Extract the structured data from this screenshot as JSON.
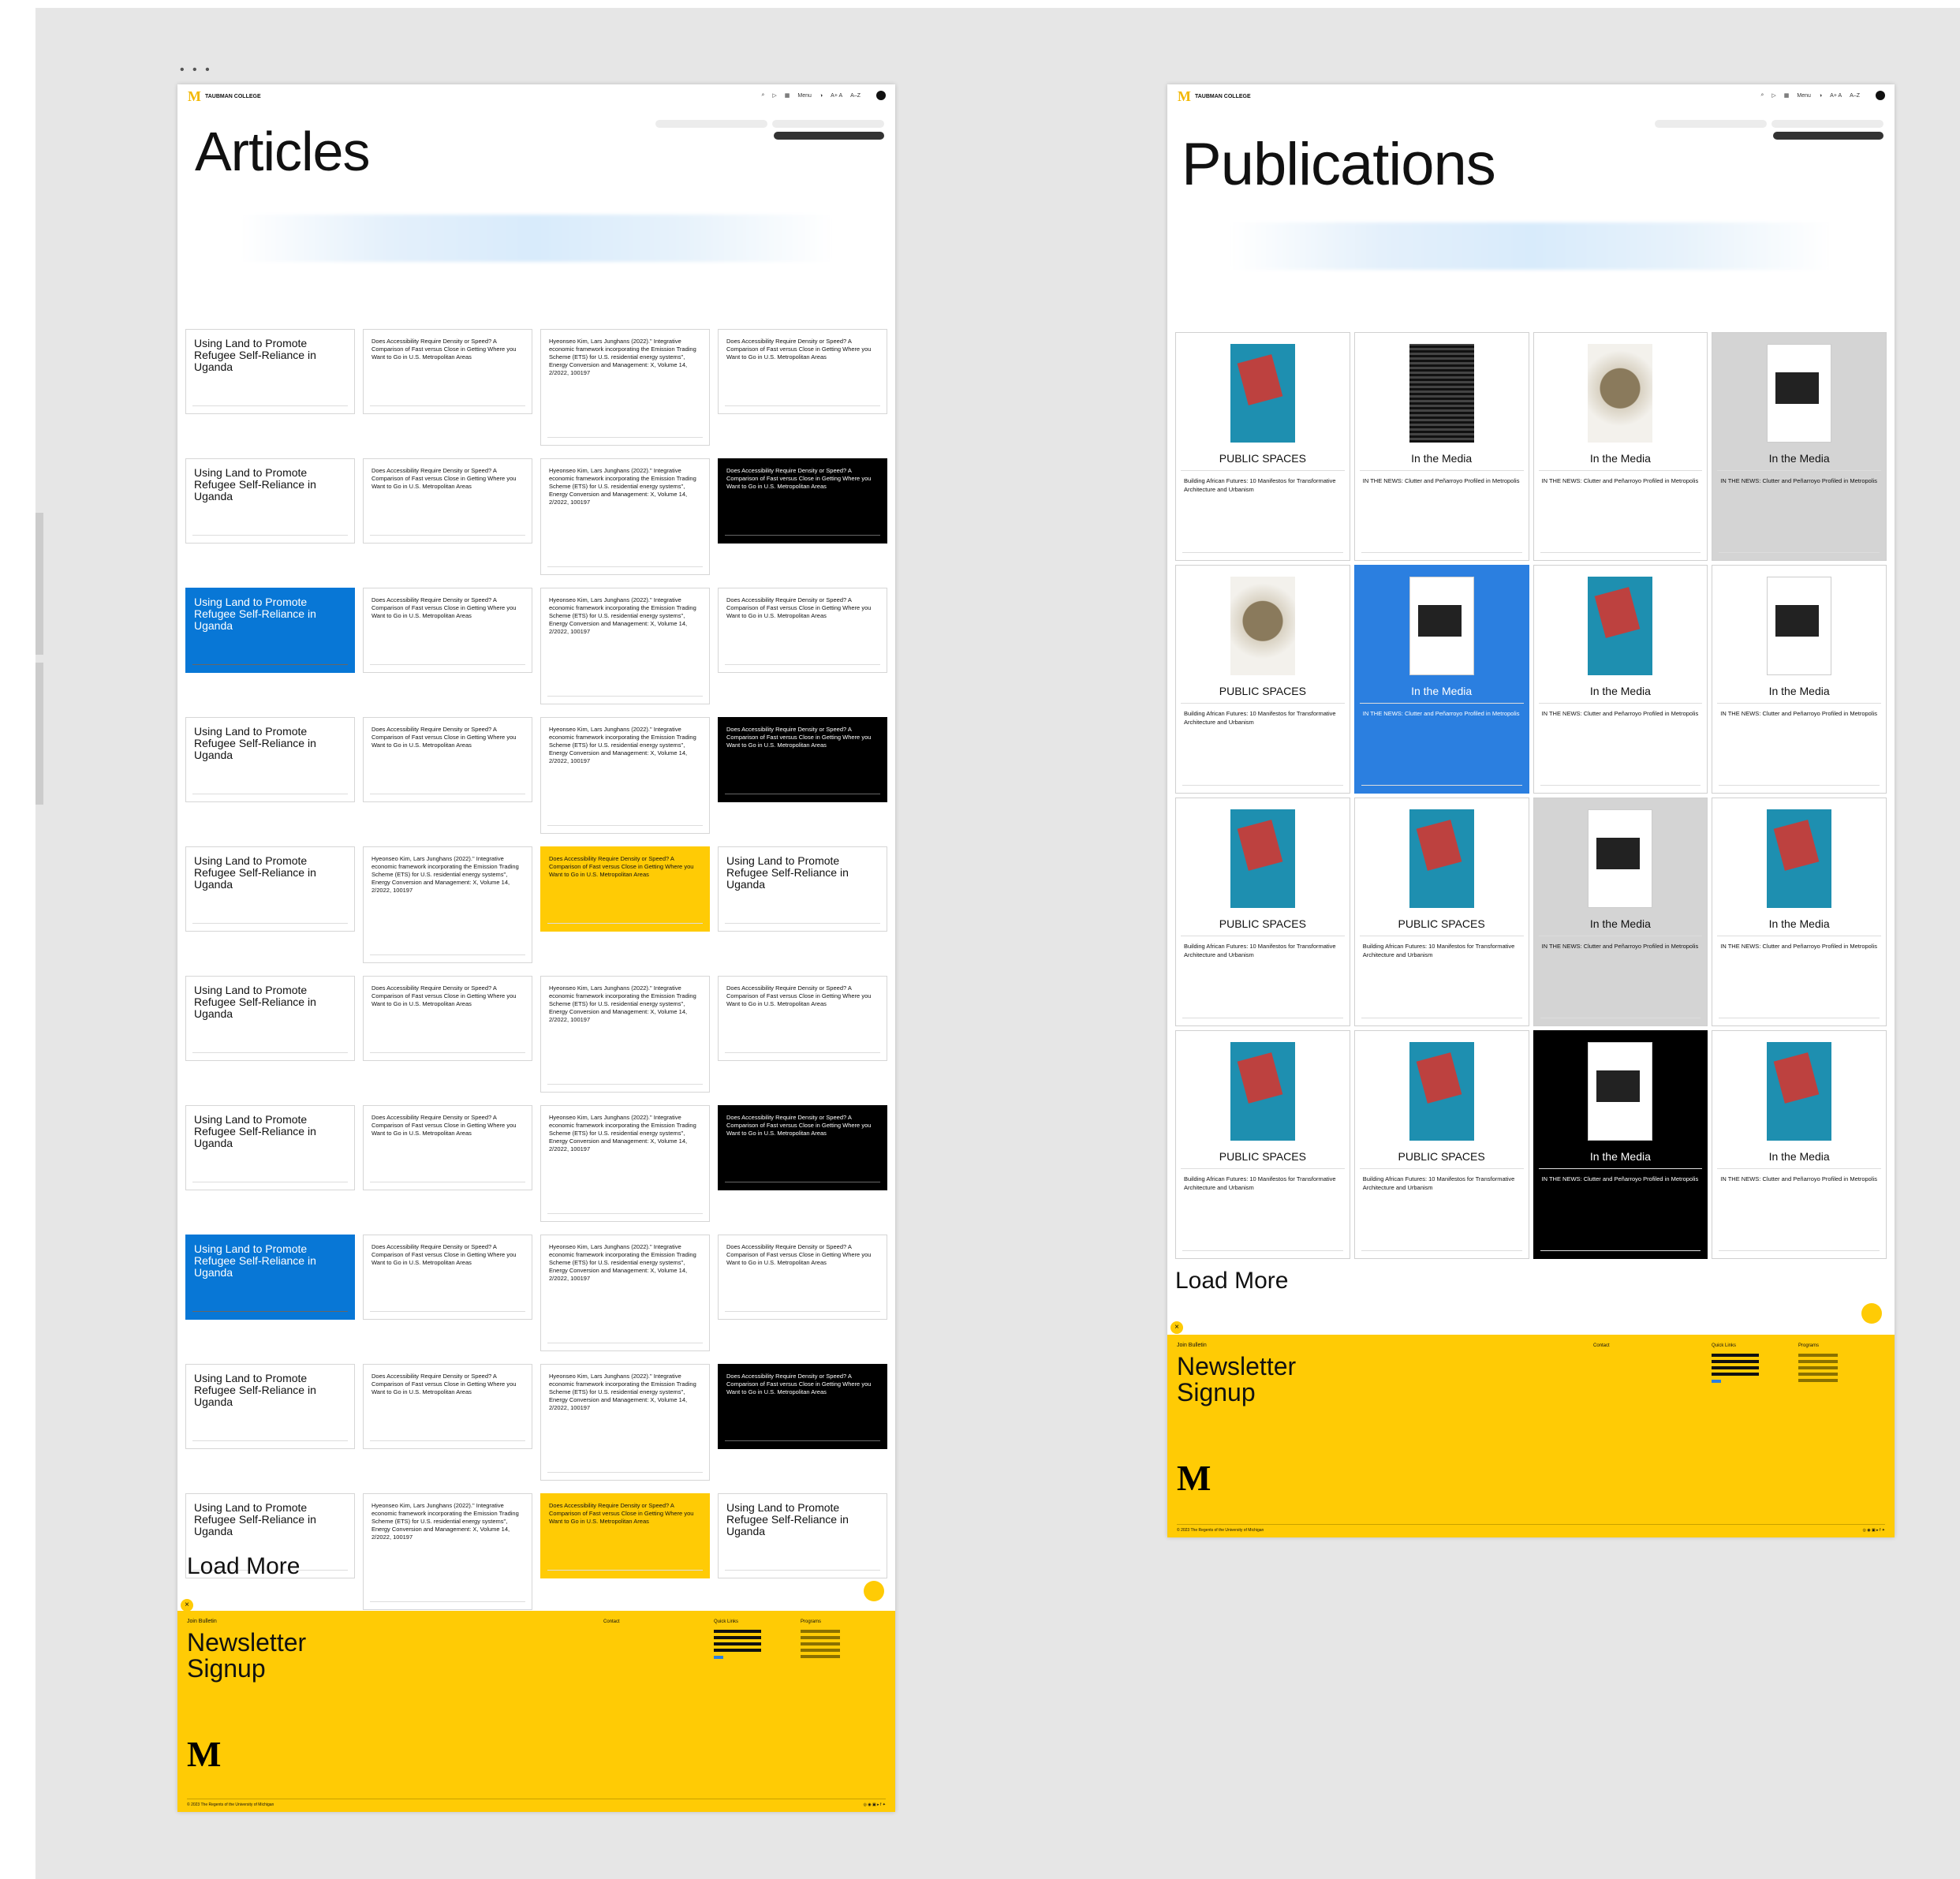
{
  "header": {
    "logo": "TAUBMAN COLLEGE",
    "menu": "Menu",
    "fontsize": "A+ A",
    "az": "A–Z",
    "user": ""
  },
  "articles": {
    "title": "Articles",
    "filter1": "",
    "filter2": "",
    "search": "",
    "loadmore": "Load More",
    "texts": {
      "A": "Using Land to Promote Refugee Self-Reliance in Uganda",
      "B": "Does Accessibility Require Density or Speed? A Comparison of Fast versus Close in Getting Where you Want to Go in U.S. Metropolitan Areas",
      "C": "Hyeonseo Kim, Lars Junghans (2022).\" Integrative economic framework incorporating the Emission Trading Scheme (ETS) for U.S. residential energy systems\", Energy Conversion and Management: X, Volume 14, 2/2022, 100197"
    },
    "rows": [
      [
        [
          "A",
          "w"
        ],
        [
          "B",
          "w"
        ],
        [
          "C",
          "w"
        ],
        [
          "B",
          "w"
        ]
      ],
      [
        [
          "A",
          "w"
        ],
        [
          "B",
          "w"
        ],
        [
          "C",
          "w"
        ],
        [
          "B",
          "k"
        ]
      ],
      [
        [
          "A",
          "b"
        ],
        [
          "B",
          "w"
        ],
        [
          "C",
          "w"
        ],
        [
          "B",
          "w"
        ]
      ],
      [
        [
          "A",
          "w"
        ],
        [
          "B",
          "w"
        ],
        [
          "C",
          "w"
        ],
        [
          "B",
          "k"
        ]
      ],
      [
        [
          "A",
          "w"
        ],
        [
          "C",
          "w"
        ],
        [
          "B",
          "y"
        ],
        [
          "A",
          "w"
        ]
      ],
      [
        [
          "A",
          "w"
        ],
        [
          "B",
          "w"
        ],
        [
          "C",
          "w"
        ],
        [
          "B",
          "w"
        ]
      ],
      [
        [
          "A",
          "w"
        ],
        [
          "B",
          "w"
        ],
        [
          "C",
          "w"
        ],
        [
          "B",
          "k"
        ]
      ],
      [
        [
          "A",
          "b"
        ],
        [
          "B",
          "w"
        ],
        [
          "C",
          "w"
        ],
        [
          "B",
          "w"
        ]
      ],
      [
        [
          "A",
          "w"
        ],
        [
          "B",
          "w"
        ],
        [
          "C",
          "w"
        ],
        [
          "B",
          "k"
        ]
      ],
      [
        [
          "A",
          "w"
        ],
        [
          "C",
          "w"
        ],
        [
          "B",
          "y"
        ],
        [
          "A",
          "w"
        ]
      ]
    ]
  },
  "publications": {
    "title": "Publications",
    "filter1": "",
    "filter2": "",
    "search": "",
    "loadmore": "Load More",
    "bodies": {
      "P": "Building African Futures: 10 Manifestos for Transformative Architecture and Urbanism",
      "M": "IN THE NEWS: Clutter and Peñarroyo Profiled in Metropolis"
    },
    "cards": [
      {
        "cover": "red",
        "tag": "PUBLIC SPACES",
        "body": "P",
        "theme": "w"
      },
      {
        "cover": "bw",
        "tag": "In the Media",
        "body": "M",
        "theme": "w"
      },
      {
        "cover": "rock",
        "tag": "In the Media",
        "body": "M",
        "theme": "w"
      },
      {
        "cover": "img",
        "tag": "In the Media",
        "body": "M",
        "theme": "g"
      },
      {
        "cover": "rock",
        "tag": "PUBLIC SPACES",
        "body": "P",
        "theme": "w"
      },
      {
        "cover": "img",
        "tag": "In the Media",
        "body": "M",
        "theme": "b"
      },
      {
        "cover": "red",
        "tag": "In the Media",
        "body": "M",
        "theme": "w"
      },
      {
        "cover": "img",
        "tag": "In the Media",
        "body": "M",
        "theme": "w"
      },
      {
        "cover": "red",
        "tag": "PUBLIC SPACES",
        "body": "P",
        "theme": "w"
      },
      {
        "cover": "red",
        "tag": "PUBLIC SPACES",
        "body": "P",
        "theme": "w"
      },
      {
        "cover": "img",
        "tag": "In the Media",
        "body": "M",
        "theme": "g"
      },
      {
        "cover": "red",
        "tag": "In the Media",
        "body": "M",
        "theme": "w"
      },
      {
        "cover": "red",
        "tag": "PUBLIC SPACES",
        "body": "P",
        "theme": "w"
      },
      {
        "cover": "red",
        "tag": "PUBLIC SPACES",
        "body": "P",
        "theme": "w"
      },
      {
        "cover": "img",
        "tag": "In the Media",
        "body": "M",
        "theme": "k"
      },
      {
        "cover": "red",
        "tag": "In the Media",
        "body": "M",
        "theme": "w"
      }
    ]
  },
  "footer": {
    "join": "Join Bulletin",
    "nl1": "Newsletter",
    "nl2": "Signup",
    "desc": "",
    "contact": "Contact",
    "quick": "Quick Links",
    "programs": "Programs",
    "copyright": "© 2023 The Regents of the University of Michigan"
  }
}
